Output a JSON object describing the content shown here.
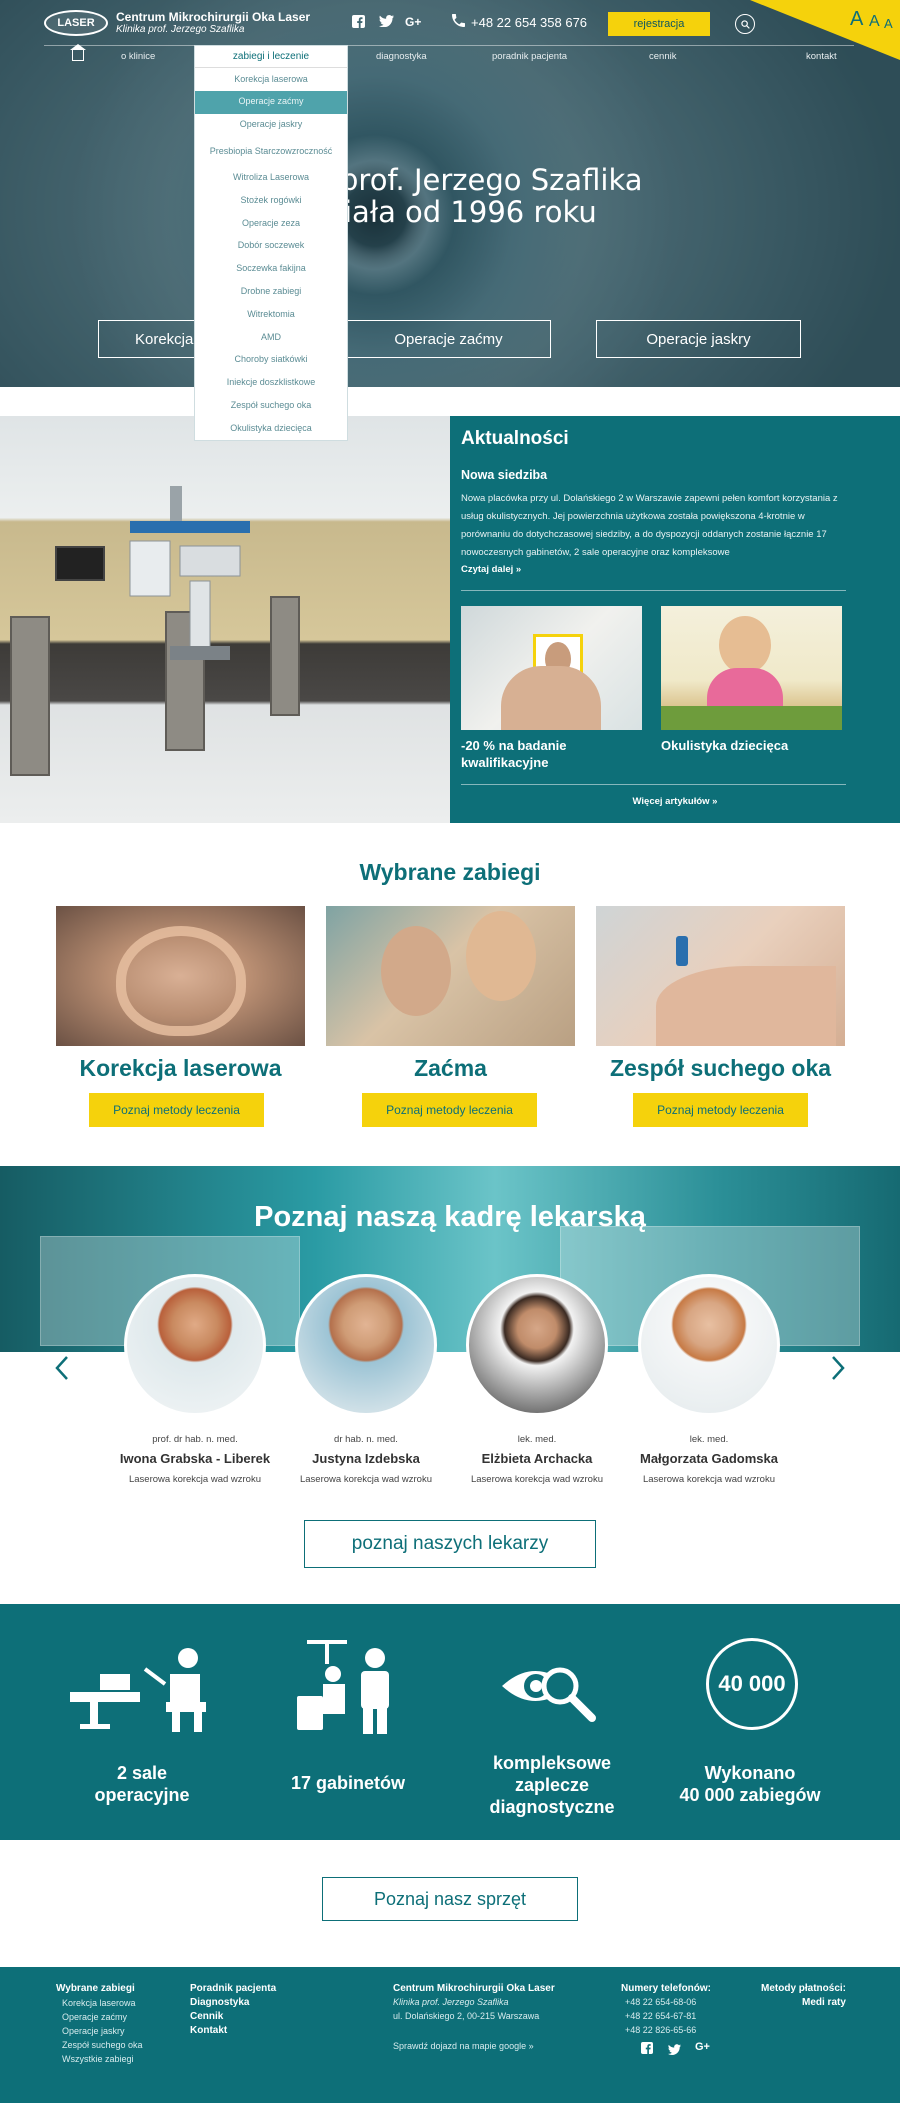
{
  "header": {
    "logo_text": "LASER",
    "brand_title": "Centrum Mikrochirurgii Oka Laser",
    "brand_subtitle": "Klinika prof. Jerzego Szaflika",
    "phone": "+48 22 654 358 676",
    "register_label": "rejestracja",
    "font_size_labels": [
      "A",
      "A",
      "A"
    ]
  },
  "nav": {
    "items": [
      "o klinice",
      "zabiegi i leczenie",
      "diagnostyka",
      "poradnik pacjenta",
      "cennik",
      "kontakt"
    ]
  },
  "dropdown": {
    "items": [
      "Korekcja laserowa",
      "Operacje zaćmy",
      "Operacje jaskry",
      "Presbiopia Starczowzroczność",
      "Witroliza Laserowa",
      "Stożek rogówki",
      "Operacje zeza",
      "Dobór soczewek",
      "Soczewka fakijna",
      "Drobne zabiegi",
      "Witrektomia",
      "AMD",
      "Choroby siatkówki",
      "Iniekcje doszklistkowe",
      "Zespół suchego oka",
      "Okulistyka dziecięca"
    ],
    "active_index": 1
  },
  "hero": {
    "title_line1": "prof. Jerzego Szaflika",
    "title_line2": "iała od 1996 roku",
    "buttons": [
      "Korekcja",
      "Operacje zaćmy",
      "Operacje jaskry"
    ]
  },
  "news": {
    "title": "Aktualności",
    "headline": "Nowa siedziba",
    "body": "Nowa placówka przy ul. Dolańskiego 2 w Warszawie zapewni pełen komfort korzystania z usług okulistycznych. Jej powierzchnia użytkowa została powiększona 4-krotnie w porównaniu do dotychczasowej siedziby, a do dyspozycji oddanych zostanie łącznie 17 nowoczesnych gabinetów, 2 sale operacyjne oraz kompleksowe",
    "read_more": "Czytaj dalej »",
    "cards": [
      "-20 % na badanie kwalifikacyjne",
      "Okulistyka dziecięca"
    ],
    "more_articles": "Więcej artykułów »"
  },
  "treatments": {
    "title": "Wybrane zabiegi",
    "items": [
      {
        "name": "Korekcja laserowa",
        "button": "Poznaj metody leczenia"
      },
      {
        "name": "Zaćma",
        "button": "Poznaj metody leczenia"
      },
      {
        "name": "Zespół suchego oka",
        "button": "Poznaj metody leczenia"
      }
    ]
  },
  "doctors": {
    "title": "Poznaj naszą kadrę lekarską",
    "items": [
      {
        "degree": "prof. dr hab. n. med.",
        "name": "Iwona Grabska - Liberek",
        "spec": "Laserowa korekcja wad wzroku"
      },
      {
        "degree": "dr hab. n. med.",
        "name": "Justyna Izdebska",
        "spec": "Laserowa korekcja wad wzroku"
      },
      {
        "degree": "lek. med.",
        "name": "Elżbieta Archacka",
        "spec": "Laserowa korekcja wad wzroku"
      },
      {
        "degree": "lek. med.",
        "name": "Małgorzata Gadomska",
        "spec": "Laserowa korekcja wad wzroku"
      }
    ],
    "button": "poznaj naszych lekarzy"
  },
  "stats": {
    "items": [
      {
        "line1": "2 sale",
        "line2": "operacyjne",
        "line3": ""
      },
      {
        "line1": "17 gabinetów",
        "line2": "",
        "line3": ""
      },
      {
        "line1": "kompleksowe",
        "line2": "zaplecze",
        "line3": "diagnostyczne"
      },
      {
        "line1": "Wykonano",
        "line2": "40 000 zabiegów",
        "line3": ""
      }
    ],
    "badge": "40 000"
  },
  "equipment_button": "Poznaj nasz sprzęt",
  "footer": {
    "col1_title": "Wybrane zabiegi",
    "col1_items": [
      "Korekcja laserowa",
      "Operacje zaćmy",
      "Operacje jaskry",
      "Zespół suchego oka",
      "Wszystkie zabiegi"
    ],
    "col2_items": [
      "Poradnik pacjenta",
      "Diagnostyka",
      "Cennik",
      "Kontakt"
    ],
    "address_title": "Centrum Mikrochirurgii Oka Laser",
    "address_sub": "Klinika prof. Jerzego Szaflika",
    "address": "ul. Dolańskiego 2, 00-215 Warszawa",
    "map_link": "Sprawdź dojazd na mapie google »",
    "phones_title": "Numery telefonów:",
    "phones": [
      "+48 22 654-68-06",
      "+48 22 654-67-81",
      "+48 22 826-65-66"
    ],
    "payments_title": "Metody płatności:",
    "payments": "Medi raty"
  },
  "colors": {
    "teal": "#0d6f78",
    "yellow": "#f5d20c"
  }
}
